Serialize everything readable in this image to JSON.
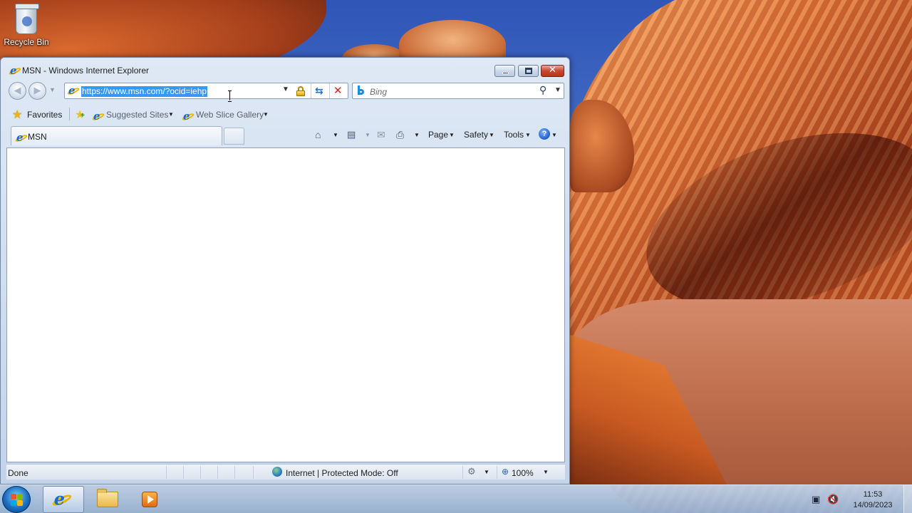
{
  "desktop": {
    "recycle_bin_label": "Recycle Bin"
  },
  "window": {
    "title": "MSN - Windows Internet Explorer",
    "icon": "ie-icon"
  },
  "navigation": {
    "address_url": "https://www.msn.com/?ocid=iehp",
    "search_placeholder": "Bing",
    "search_provider_icon": "bing-icon"
  },
  "favorites_bar": {
    "favorites_label": "Favorites",
    "links": [
      {
        "label": "Suggested Sites"
      },
      {
        "label": "Web Slice Gallery"
      }
    ]
  },
  "tabs": [
    {
      "label": "MSN",
      "active": true
    }
  ],
  "command_bar": {
    "page_label": "Page",
    "safety_label": "Safety",
    "tools_label": "Tools"
  },
  "status_bar": {
    "status": "Done",
    "zone": "Internet | Protected Mode: Off",
    "zoom": "100%"
  },
  "taskbar": {
    "pinned": [
      "internet-explorer",
      "windows-explorer",
      "media-player"
    ],
    "time": "11:53",
    "date": "14/09/2023"
  },
  "colors": {
    "selection": "#3399ff",
    "window_frame": "#cfdcee",
    "close_button": "#c8482f"
  }
}
